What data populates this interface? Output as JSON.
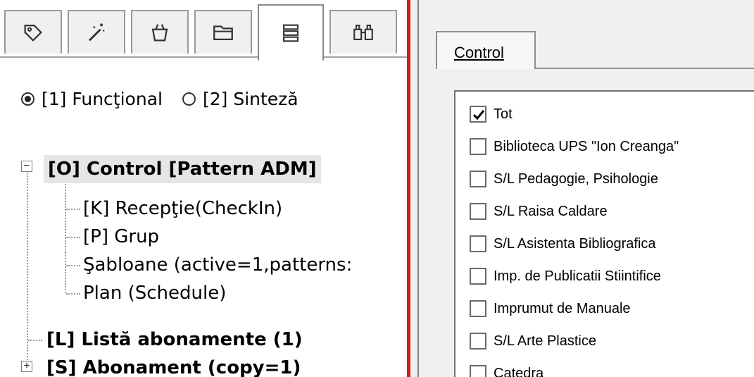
{
  "left_panel": {
    "tabs": [
      {
        "icon": "tag-icon",
        "active": false
      },
      {
        "icon": "wand-icon",
        "active": false
      },
      {
        "icon": "basket-icon",
        "active": false
      },
      {
        "icon": "folder-icon",
        "active": false
      },
      {
        "icon": "list-icon",
        "active": true
      },
      {
        "icon": "binoculars-icon",
        "active": false
      }
    ],
    "radio_options": [
      {
        "label": "[1] Funcţional",
        "selected": true
      },
      {
        "label": "[2] Sinteză",
        "selected": false
      }
    ],
    "tree": {
      "root": {
        "label": "[O] Control [Pattern ADM]",
        "expanded": true,
        "selected": true
      },
      "children": [
        {
          "label": "[K] Recepţie(CheckIn)"
        },
        {
          "label": "[P] Grup"
        },
        {
          "label": "Şabloane (active=1,patterns:"
        },
        {
          "label": "Plan (Schedule)"
        }
      ],
      "siblings": [
        {
          "label": "[L] Listă abonamente (1)"
        },
        {
          "label": "[S] Abonament (copy=1)"
        }
      ]
    }
  },
  "right_panel": {
    "tab_label": "Control",
    "items": [
      {
        "label": "Tot",
        "checked": true
      },
      {
        "label": "Biblioteca UPS \"Ion Creanga\"",
        "checked": false
      },
      {
        "label": "S/L Pedagogie, Psihologie",
        "checked": false
      },
      {
        "label": "S/L Raisa Caldare",
        "checked": false
      },
      {
        "label": "S/L Asistenta Bibliografica",
        "checked": false
      },
      {
        "label": "Imp. de Publicatii Stiintifice",
        "checked": false
      },
      {
        "label": "Imprumut de Manuale",
        "checked": false
      },
      {
        "label": "S/L Arte Plastice",
        "checked": false
      },
      {
        "label": "Catedra",
        "checked": false
      }
    ]
  },
  "colors": {
    "splitter": "#d21a1a"
  }
}
